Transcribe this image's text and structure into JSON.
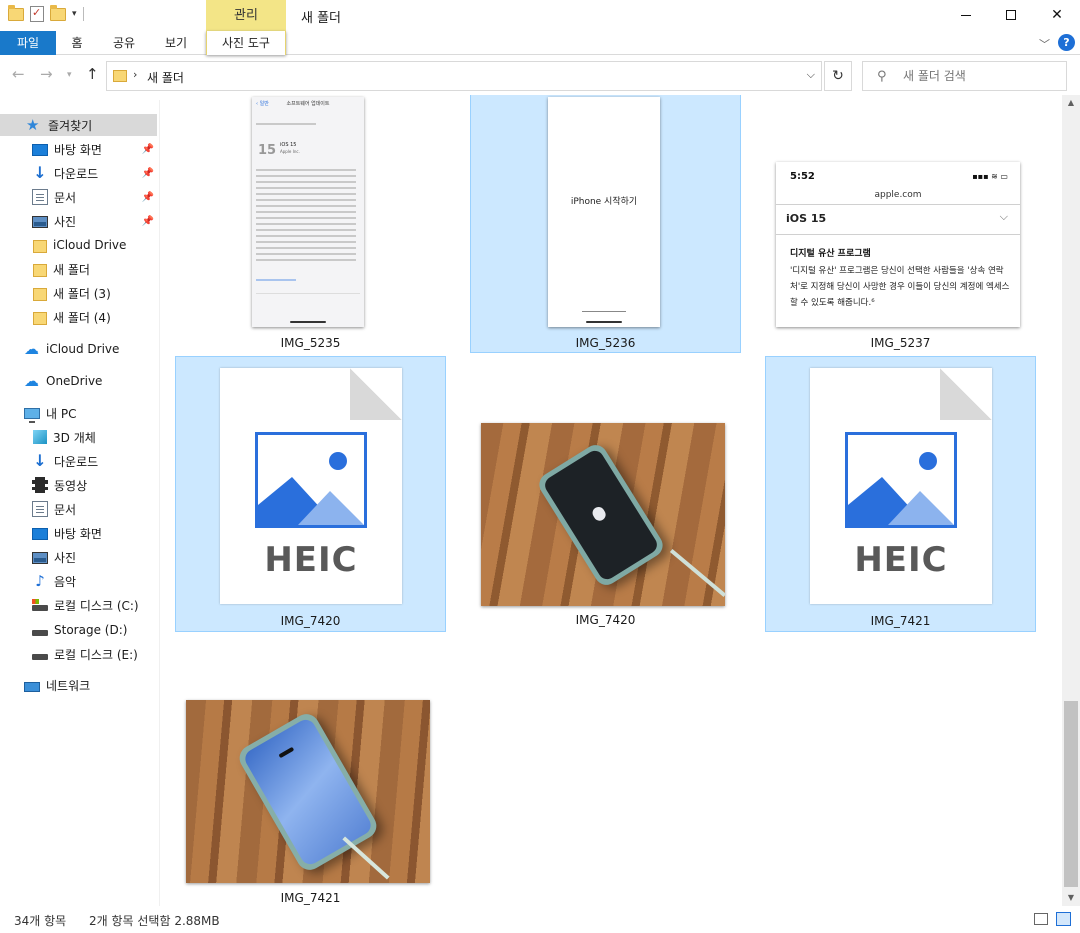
{
  "window": {
    "title": "새 폴더",
    "context_tab_group": "관리",
    "controls": {
      "minimize": "—",
      "maximize": "☐",
      "close": "✕"
    }
  },
  "ribbon": {
    "tabs": [
      "파일",
      "홈",
      "공유",
      "보기",
      "사진 도구"
    ],
    "expand_icon": "chevron-down",
    "help": "?"
  },
  "address": {
    "path": "새 폴더",
    "separator": "›",
    "search_placeholder": "새 폴더 검색"
  },
  "nav_pane": {
    "quick_access": "즐겨찾기",
    "quick_items": [
      {
        "label": "바탕 화면",
        "pinned": true
      },
      {
        "label": "다운로드",
        "pinned": true
      },
      {
        "label": "문서",
        "pinned": true
      },
      {
        "label": "사진",
        "pinned": true
      },
      {
        "label": "iCloud Drive",
        "pinned": false
      },
      {
        "label": "새 폴더",
        "pinned": false
      },
      {
        "label": "새 폴더 (3)",
        "pinned": false
      },
      {
        "label": "새 폴더 (4)",
        "pinned": false
      }
    ],
    "icloud": "iCloud Drive",
    "onedrive": "OneDrive",
    "this_pc": "내 PC",
    "pc_items": [
      "3D 개체",
      "다운로드",
      "동영상",
      "문서",
      "바탕 화면",
      "사진",
      "음악",
      "로컬 디스크 (C:)",
      "Storage (D:)",
      "로컬 디스크 (E:)"
    ],
    "network": "네트워크"
  },
  "files": [
    {
      "name": "IMG_5235",
      "selected": false
    },
    {
      "name": "IMG_5236",
      "selected": true
    },
    {
      "name": "IMG_5237",
      "selected": false
    },
    {
      "name": "IMG_7420",
      "selected": true
    },
    {
      "name": "IMG_7420",
      "selected": false
    },
    {
      "name": "IMG_7421",
      "selected": true
    },
    {
      "name": "IMG_7421",
      "selected": false
    }
  ],
  "thumbs": {
    "ios_update": {
      "header": "소프트웨어 업데이트",
      "version": "iOS 15",
      "line2": "Apple Inc."
    },
    "iphone_start": {
      "title": "iPhone 시작하기"
    },
    "apple_web": {
      "time": "5:52",
      "url": "apple.com",
      "section": "iOS 15",
      "heading": "디지털 유산 프로그램",
      "body": "'디지털 유산' 프로그램은 당신이 선택한 사람들을 '상속 연락처'로 지정해 당신이 사망한 경우 이들이 당신의 계정에 엑세스할 수 있도록 해줍니다.⁶"
    },
    "heic_label": "HEIC"
  },
  "status": {
    "item_count": "34개 항목",
    "selection": "2개 항목 선택함 2.88MB"
  },
  "colors": {
    "accent": "#1979ca",
    "selection_bg": "#cce8ff",
    "context_tab": "#f3e587",
    "heic_blue": "#2a6fdc"
  }
}
